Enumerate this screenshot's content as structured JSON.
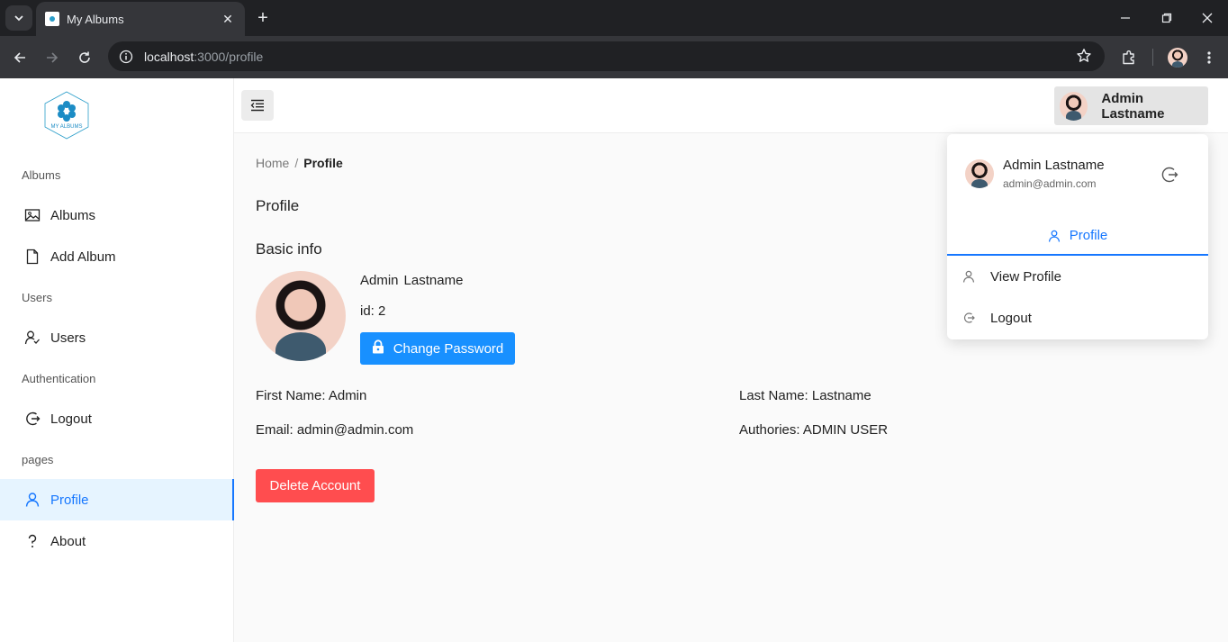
{
  "browser": {
    "tab_title": "My Albums",
    "url_host": "localhost",
    "url_rest": ":3000/profile",
    "new_tab": "+",
    "close_tab": "✕"
  },
  "sidebar": {
    "logo_text": "MY ALBUMS",
    "sections": [
      {
        "heading": "Albums",
        "items": [
          {
            "label": "Albums",
            "icon": "image-icon"
          },
          {
            "label": "Add Album",
            "icon": "file-icon"
          }
        ]
      },
      {
        "heading": "Users",
        "items": [
          {
            "label": "Users",
            "icon": "users-icon"
          }
        ]
      },
      {
        "heading": "Authentication",
        "items": [
          {
            "label": "Logout",
            "icon": "logout-icon"
          }
        ]
      },
      {
        "heading": "pages",
        "items": [
          {
            "label": "Profile",
            "icon": "user-icon",
            "active": true
          },
          {
            "label": "About",
            "icon": "question-icon"
          }
        ]
      }
    ]
  },
  "header": {
    "user_name": "Admin Lastname"
  },
  "breadcrumb": {
    "home": "Home",
    "separator": "/",
    "current": "Profile"
  },
  "main": {
    "title": "Profile",
    "section_title": "Basic info",
    "first": "Admin",
    "last": "Lastname",
    "id_line": "id: 2",
    "change_password": "Change Password",
    "first_name_line": "First Name: Admin",
    "last_name_line": "Last Name: Lastname",
    "email_line": "Email: admin@admin.com",
    "authorities_line": "Authories: ADMIN USER",
    "delete_account": "Delete Account"
  },
  "dropdown": {
    "name": "Admin Lastname",
    "email": "admin@admin.com",
    "tab_label": "Profile",
    "items": [
      {
        "label": "View Profile",
        "icon": "user-icon"
      },
      {
        "label": "Logout",
        "icon": "logout-icon"
      }
    ]
  },
  "colors": {
    "primary": "#1890ff",
    "active_link": "#1677ff",
    "danger": "#ff4d4f",
    "active_bg": "#e6f4ff"
  }
}
